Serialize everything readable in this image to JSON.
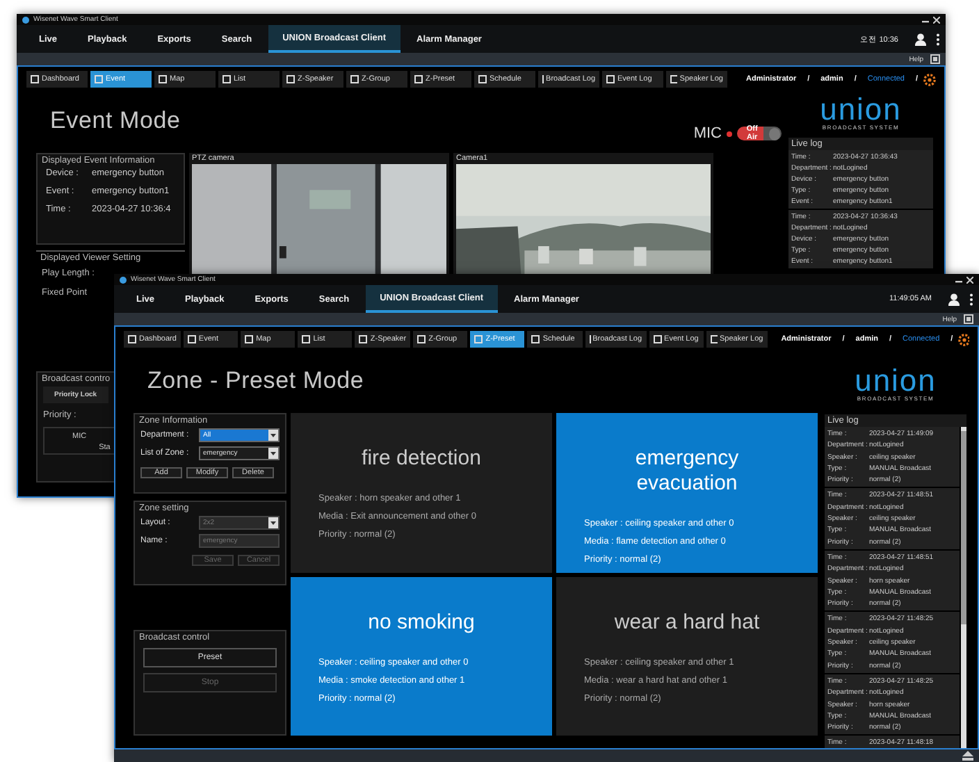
{
  "back_window": {
    "title": "Wisenet Wave Smart Client",
    "nav_tabs": [
      {
        "label": "Live",
        "selected": false
      },
      {
        "label": "Playback",
        "selected": false
      },
      {
        "label": "Exports",
        "selected": false
      },
      {
        "label": "Search",
        "selected": false
      },
      {
        "label": "UNION Broadcast Client",
        "selected": true
      },
      {
        "label": "Alarm Manager",
        "selected": false
      }
    ],
    "time": "오전 10:36",
    "help": "Help",
    "toolbar": [
      {
        "label": "Dashboard",
        "selected": false
      },
      {
        "label": "Event",
        "selected": true
      },
      {
        "label": "Map",
        "selected": false
      },
      {
        "label": "List",
        "selected": false
      },
      {
        "label": "Z-Speaker",
        "selected": false
      },
      {
        "label": "Z-Group",
        "selected": false
      },
      {
        "label": "Z-Preset",
        "selected": false
      },
      {
        "label": "Schedule",
        "selected": false
      },
      {
        "label": "Broadcast Log",
        "selected": false
      },
      {
        "label": "Event Log",
        "selected": false
      },
      {
        "label": "Speaker Log",
        "selected": false
      }
    ],
    "user_status": [
      {
        "text": "Administrator",
        "kind": "role"
      },
      {
        "text": "/",
        "kind": "sep"
      },
      {
        "text": "admin",
        "kind": "role"
      },
      {
        "text": "/",
        "kind": "sep"
      },
      {
        "text": "Connected",
        "kind": "status"
      },
      {
        "text": "/",
        "kind": "sep"
      }
    ],
    "heading": "Event Mode",
    "mic": {
      "label": "MIC",
      "toggle": "Off Air",
      "on": false
    },
    "logo": {
      "name": "union",
      "tagline": "BROADCAST SYSTEM"
    },
    "event_info": {
      "title": "Displayed Event Information",
      "rows": [
        {
          "label": "Device :",
          "value": "emergency button"
        },
        {
          "label": "Event :",
          "value": "emergency button1"
        },
        {
          "label": "Time :",
          "value": "2023-04-27 10:36:4"
        }
      ]
    },
    "viewer_setting": {
      "title": "Displayed Viewer Setting",
      "rows": [
        "Play Length :",
        "Fixed Point"
      ]
    },
    "broadcast_control": {
      "title": "Broadcast contro",
      "lock_button": "Priority Lock",
      "priority_label": "Priority :",
      "mic_label": "MIC",
      "start_label": "Sta"
    },
    "cameras": [
      {
        "label": "PTZ camera",
        "kind": "picture"
      },
      {
        "label": "Camera1",
        "kind": "picture"
      }
    ],
    "live_log": {
      "title": "Live log",
      "entries": [
        {
          "fields": [
            {
              "label": "Time :",
              "value": "2023-04-27 10:36:43"
            },
            {
              "label": "Department :",
              "value": "notLogined"
            },
            {
              "label": "Device :",
              "value": "emergency button"
            },
            {
              "label": "Type :",
              "value": "emergency button"
            },
            {
              "label": "Event :",
              "value": "emergency button1"
            }
          ]
        },
        {
          "fields": [
            {
              "label": "Time :",
              "value": "2023-04-27 10:36:43"
            },
            {
              "label": "Department :",
              "value": "notLogined"
            },
            {
              "label": "Device :",
              "value": "emergency button"
            },
            {
              "label": "Type :",
              "value": "emergency button"
            },
            {
              "label": "Event :",
              "value": "emergency button1"
            }
          ]
        }
      ]
    }
  },
  "front_window": {
    "title": "Wisenet Wave Smart Client",
    "nav_tabs": [
      {
        "label": "Live",
        "selected": false
      },
      {
        "label": "Playback",
        "selected": false
      },
      {
        "label": "Exports",
        "selected": false
      },
      {
        "label": "Search",
        "selected": false
      },
      {
        "label": "UNION Broadcast Client",
        "selected": true
      },
      {
        "label": "Alarm Manager",
        "selected": false
      }
    ],
    "time": "11:49:05 AM",
    "help": "Help",
    "toolbar": [
      {
        "label": "Dashboard",
        "selected": false
      },
      {
        "label": "Event",
        "selected": false
      },
      {
        "label": "Map",
        "selected": false
      },
      {
        "label": "List",
        "selected": false
      },
      {
        "label": "Z-Speaker",
        "selected": false
      },
      {
        "label": "Z-Group",
        "selected": false
      },
      {
        "label": "Z-Preset",
        "selected": true
      },
      {
        "label": "Schedule",
        "selected": false
      },
      {
        "label": "Broadcast Log",
        "selected": false
      },
      {
        "label": "Event Log",
        "selected": false
      },
      {
        "label": "Speaker Log",
        "selected": false
      }
    ],
    "user_status": [
      {
        "text": "Administrator",
        "kind": "role"
      },
      {
        "text": "/",
        "kind": "sep"
      },
      {
        "text": "admin",
        "kind": "role"
      },
      {
        "text": "/",
        "kind": "sep"
      },
      {
        "text": "Connected",
        "kind": "status"
      },
      {
        "text": "/",
        "kind": "sep"
      }
    ],
    "heading": "Zone - Preset Mode",
    "logo": {
      "name": "union",
      "tagline": "BROADCAST SYSTEM"
    },
    "zone_info": {
      "title": "Zone Information",
      "fields": [
        {
          "label": "Department :",
          "value": "All",
          "focused": true
        },
        {
          "label": "List of Zone :",
          "value": "emergency",
          "focused": false
        }
      ],
      "buttons": [
        "Add",
        "Modify",
        "Delete"
      ]
    },
    "zone_setting": {
      "title": "Zone setting",
      "fields": [
        {
          "label": "Layout :",
          "value": "2x2",
          "kind": "select"
        },
        {
          "label": "Name :",
          "value": "emergency",
          "kind": "input"
        }
      ],
      "buttons": [
        {
          "label": "Save",
          "disabled": true
        },
        {
          "label": "Cancel",
          "disabled": true
        }
      ]
    },
    "broadcast_control": {
      "title": "Broadcast control",
      "buttons": [
        {
          "label": "Preset",
          "disabled": false
        },
        {
          "label": "Stop",
          "disabled": true
        }
      ]
    },
    "presets": [
      {
        "title": "fire detection",
        "selected": false,
        "lines": [
          "Speaker : horn speaker and other 1",
          "Media : Exit announcement  and other 0",
          "Priority : normal (2)"
        ]
      },
      {
        "title": "emergency evacuation",
        "selected": true,
        "lines": [
          "Speaker : ceiling speaker and other 0",
          "Media : flame detection and other 0",
          "Priority : normal (2)"
        ]
      },
      {
        "title": "no smoking",
        "selected": true,
        "lines": [
          "Speaker : ceiling speaker and other 0",
          "Media : smoke detection and other 1",
          "Priority : normal (2)"
        ]
      },
      {
        "title": "wear a hard hat",
        "selected": false,
        "lines": [
          "Speaker : ceiling speaker and other 1",
          "Media : wear a hard hat and other 1",
          "Priority : normal (2)"
        ]
      }
    ],
    "live_log": {
      "title": "Live log",
      "entries": [
        {
          "fields": [
            {
              "label": "Time :",
              "value": "2023-04-27 11:49:09"
            },
            {
              "label": "Department :",
              "value": "notLogined"
            },
            {
              "label": "Speaker :",
              "value": "ceiling speaker"
            },
            {
              "label": "Type :",
              "value": "MANUAL Broadcast"
            },
            {
              "label": "Priority :",
              "value": "normal (2)"
            }
          ]
        },
        {
          "fields": [
            {
              "label": "Time :",
              "value": "2023-04-27 11:48:51"
            },
            {
              "label": "Department :",
              "value": "notLogined"
            },
            {
              "label": "Speaker :",
              "value": "ceiling speaker"
            },
            {
              "label": "Type :",
              "value": "MANUAL Broadcast"
            },
            {
              "label": "Priority :",
              "value": "normal (2)"
            }
          ]
        },
        {
          "fields": [
            {
              "label": "Time :",
              "value": "2023-04-27 11:48:51"
            },
            {
              "label": "Department :",
              "value": "notLogined"
            },
            {
              "label": "Speaker :",
              "value": "horn speaker"
            },
            {
              "label": "Type :",
              "value": "MANUAL Broadcast"
            },
            {
              "label": "Priority :",
              "value": "normal (2)"
            }
          ]
        },
        {
          "fields": [
            {
              "label": "Time :",
              "value": "2023-04-27 11:48:25"
            },
            {
              "label": "Department :",
              "value": "notLogined"
            },
            {
              "label": "Speaker :",
              "value": "ceiling speaker"
            },
            {
              "label": "Type :",
              "value": "MANUAL Broadcast"
            },
            {
              "label": "Priority :",
              "value": "normal (2)"
            }
          ]
        },
        {
          "fields": [
            {
              "label": "Time :",
              "value": "2023-04-27 11:48:25"
            },
            {
              "label": "Department :",
              "value": "notLogined"
            },
            {
              "label": "Speaker :",
              "value": "horn speaker"
            },
            {
              "label": "Type :",
              "value": "MANUAL Broadcast"
            },
            {
              "label": "Priority :",
              "value": "normal (2)"
            }
          ]
        },
        {
          "fields": [
            {
              "label": "Time :",
              "value": "2023-04-27 11:48:18"
            }
          ]
        }
      ]
    }
  }
}
